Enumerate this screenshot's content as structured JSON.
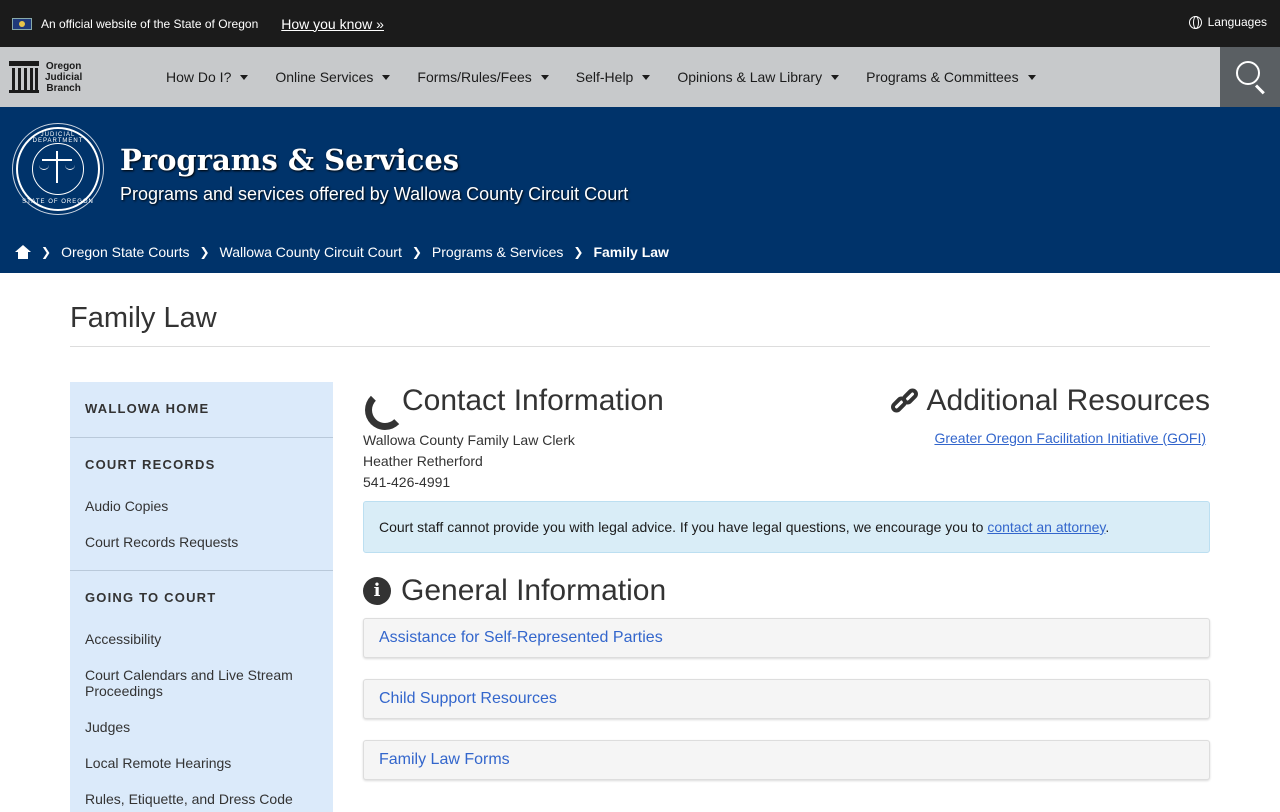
{
  "official_bar": {
    "text": "An official website of the State of Oregon",
    "how_link": "How you know »",
    "languages": "Languages"
  },
  "nav": {
    "logo_line1": "Oregon",
    "logo_line2": "Judicial",
    "logo_line3": "Branch",
    "items": [
      {
        "label": "How Do I?"
      },
      {
        "label": "Online Services"
      },
      {
        "label": "Forms/Rules/Fees"
      },
      {
        "label": "Self-Help"
      },
      {
        "label": "Opinions & Law Library"
      },
      {
        "label": "Programs & Committees"
      }
    ]
  },
  "banner": {
    "seal_top": "JUDICIAL DEPARTMENT",
    "seal_bottom": "STATE OF OREGON",
    "title": "Programs & Services",
    "subtitle": "Programs and services offered by Wallowa County Circuit Court"
  },
  "breadcrumb": {
    "items": [
      "Oregon State Courts",
      "Wallowa County Circuit Court",
      "Programs & Services"
    ],
    "current": "Family Law"
  },
  "page": {
    "title": "Family Law"
  },
  "sidebar": {
    "home": "WALLOWA HOME",
    "court_records": "COURT RECORDS",
    "court_records_links": [
      "Audio Copies",
      "Court Records Requests"
    ],
    "going_to_court": "GOING TO COURT",
    "going_to_court_links": [
      "Accessibility",
      "Court Calendars and Live Stream Proceedings",
      "Judges",
      "Local Remote Hearings",
      "Rules, Etiquette, and Dress Code"
    ]
  },
  "contact": {
    "heading": "Contact Information",
    "lines": [
      "Wallowa County Family Law Clerk",
      "Heather Retherford",
      "541-426-4991"
    ]
  },
  "resources": {
    "heading": "Additional Resources",
    "link": "Greater Oregon Facilitation Initiative (GOFI)"
  },
  "alert": {
    "text": "Court staff cannot provide you with legal advice. If you have legal questions, we encourage you to ",
    "link": "contact an attorney",
    "end": "."
  },
  "general": {
    "heading": "General Information",
    "items": [
      "Assistance for Self-Represented Parties",
      "Child Support Resources",
      "Family Law Forms"
    ]
  }
}
